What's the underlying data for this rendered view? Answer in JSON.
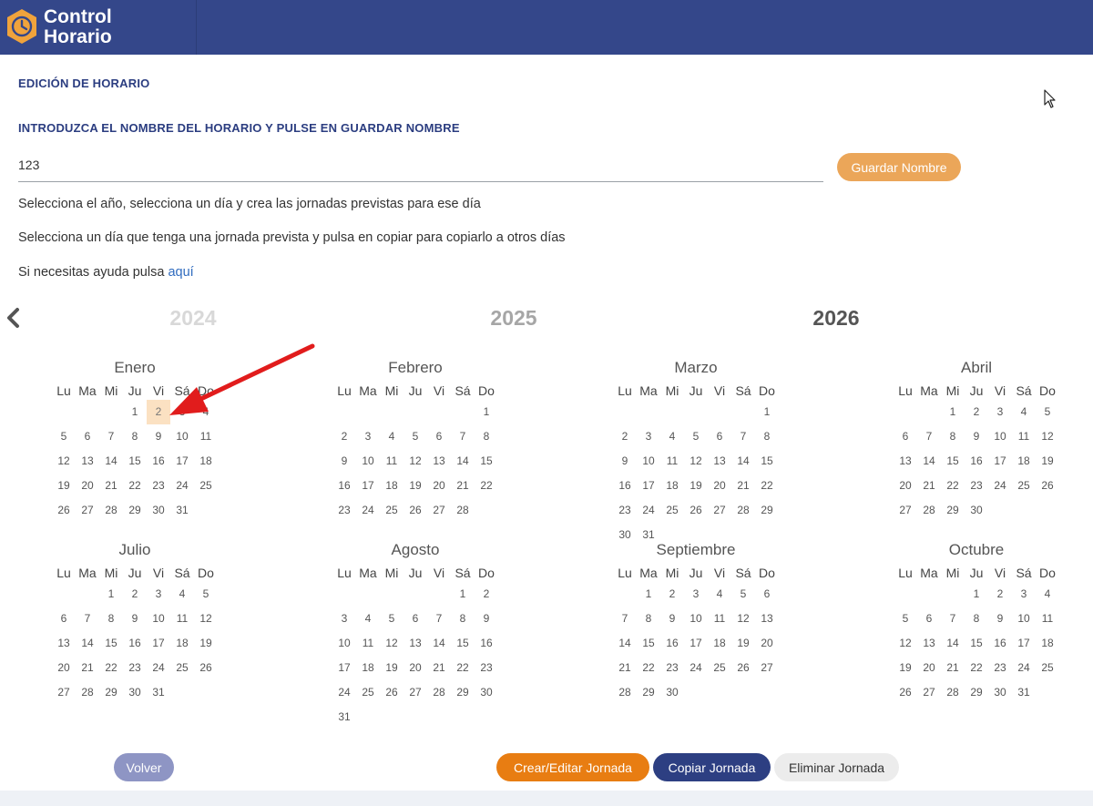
{
  "app": {
    "brand_line1": "Control",
    "brand_line2": "Horario",
    "brand_color": "#34478a",
    "accent_color": "#eba659"
  },
  "page": {
    "section_title": "EDICIÓN DE HORARIO",
    "instruction_title": "INTRODUZCA EL NOMBRE DEL HORARIO Y PULSE EN GUARDAR NOMBRE",
    "name_value": "123",
    "save_button": "Guardar Nombre",
    "info_line1": "Selecciona el año, selecciona un día y crea las jornadas previstas para ese día",
    "info_line2": "Selecciona un día que tenga una jornada prevista y pulsa en copiar para copiarlo a otros días",
    "info_line3": "Si necesitas ayuda pulsa",
    "help_link": "aquí"
  },
  "years": [
    "2024",
    "2025",
    "2026"
  ],
  "calendar": {
    "weekdays": [
      "Lu",
      "Ma",
      "Mi",
      "Ju",
      "Vi",
      "Sá",
      "Do"
    ],
    "months": [
      {
        "name": "Enero",
        "offset": 3,
        "days": 31,
        "selected_day": 2
      },
      {
        "name": "Febrero",
        "offset": 6,
        "days": 28
      },
      {
        "name": "Marzo",
        "offset": 6,
        "days": 31
      },
      {
        "name": "Abril",
        "offset": 2,
        "days": 30
      },
      {
        "name": "Julio",
        "offset": 2,
        "days": 31
      },
      {
        "name": "Agosto",
        "offset": 5,
        "days": 31
      },
      {
        "name": "Septiembre",
        "offset": 1,
        "days": 30
      },
      {
        "name": "Octubre",
        "offset": 3,
        "days": 31
      }
    ]
  },
  "actions": {
    "back": "Volver",
    "create": "Crear/Editar Jornada",
    "copy": "Copiar Jornada",
    "delete": "Eliminar Jornada"
  }
}
